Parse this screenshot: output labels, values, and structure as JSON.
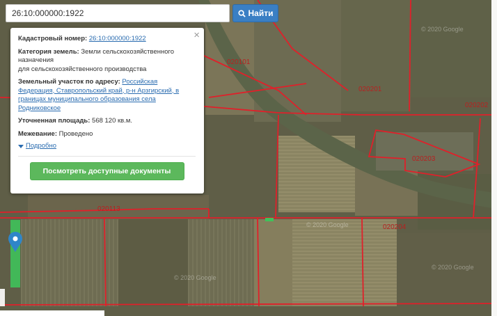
{
  "search": {
    "value": "26:10:000000:1922",
    "button_label": "Найти",
    "button_icon": "search-icon"
  },
  "popup": {
    "close_glyph": "×",
    "cadastral_label": "Кадастровый номер:",
    "cadastral_value": "26:10:000000:1922",
    "category_label": "Категория земель:",
    "category_value": "Земли сельскохозяйственного назначения",
    "category_value_2": "для сельскохозяйственного производства",
    "address_label": "Земельный участок по адресу:",
    "address_value": "Российская Федерация, Ставропольский край, р-н Арзгирский, в границах муниципального образования села Родниковское",
    "area_label": "Уточненная площадь:",
    "area_value": "568 120 кв.м.",
    "survey_label": "Межевание:",
    "survey_value": "Проведено",
    "details_link": "Подробно",
    "docs_button": "Посмотреть доступные документы"
  },
  "map": {
    "labels": [
      "020101",
      "020201",
      "020202",
      "020203",
      "020113",
      "020204"
    ],
    "watermark": "© 2020 Google",
    "boundary_color": "#e0202a",
    "highlight_color": "#3fc25a",
    "marker_color": "#2f86c9",
    "marker_icon": "map-pin-icon"
  }
}
